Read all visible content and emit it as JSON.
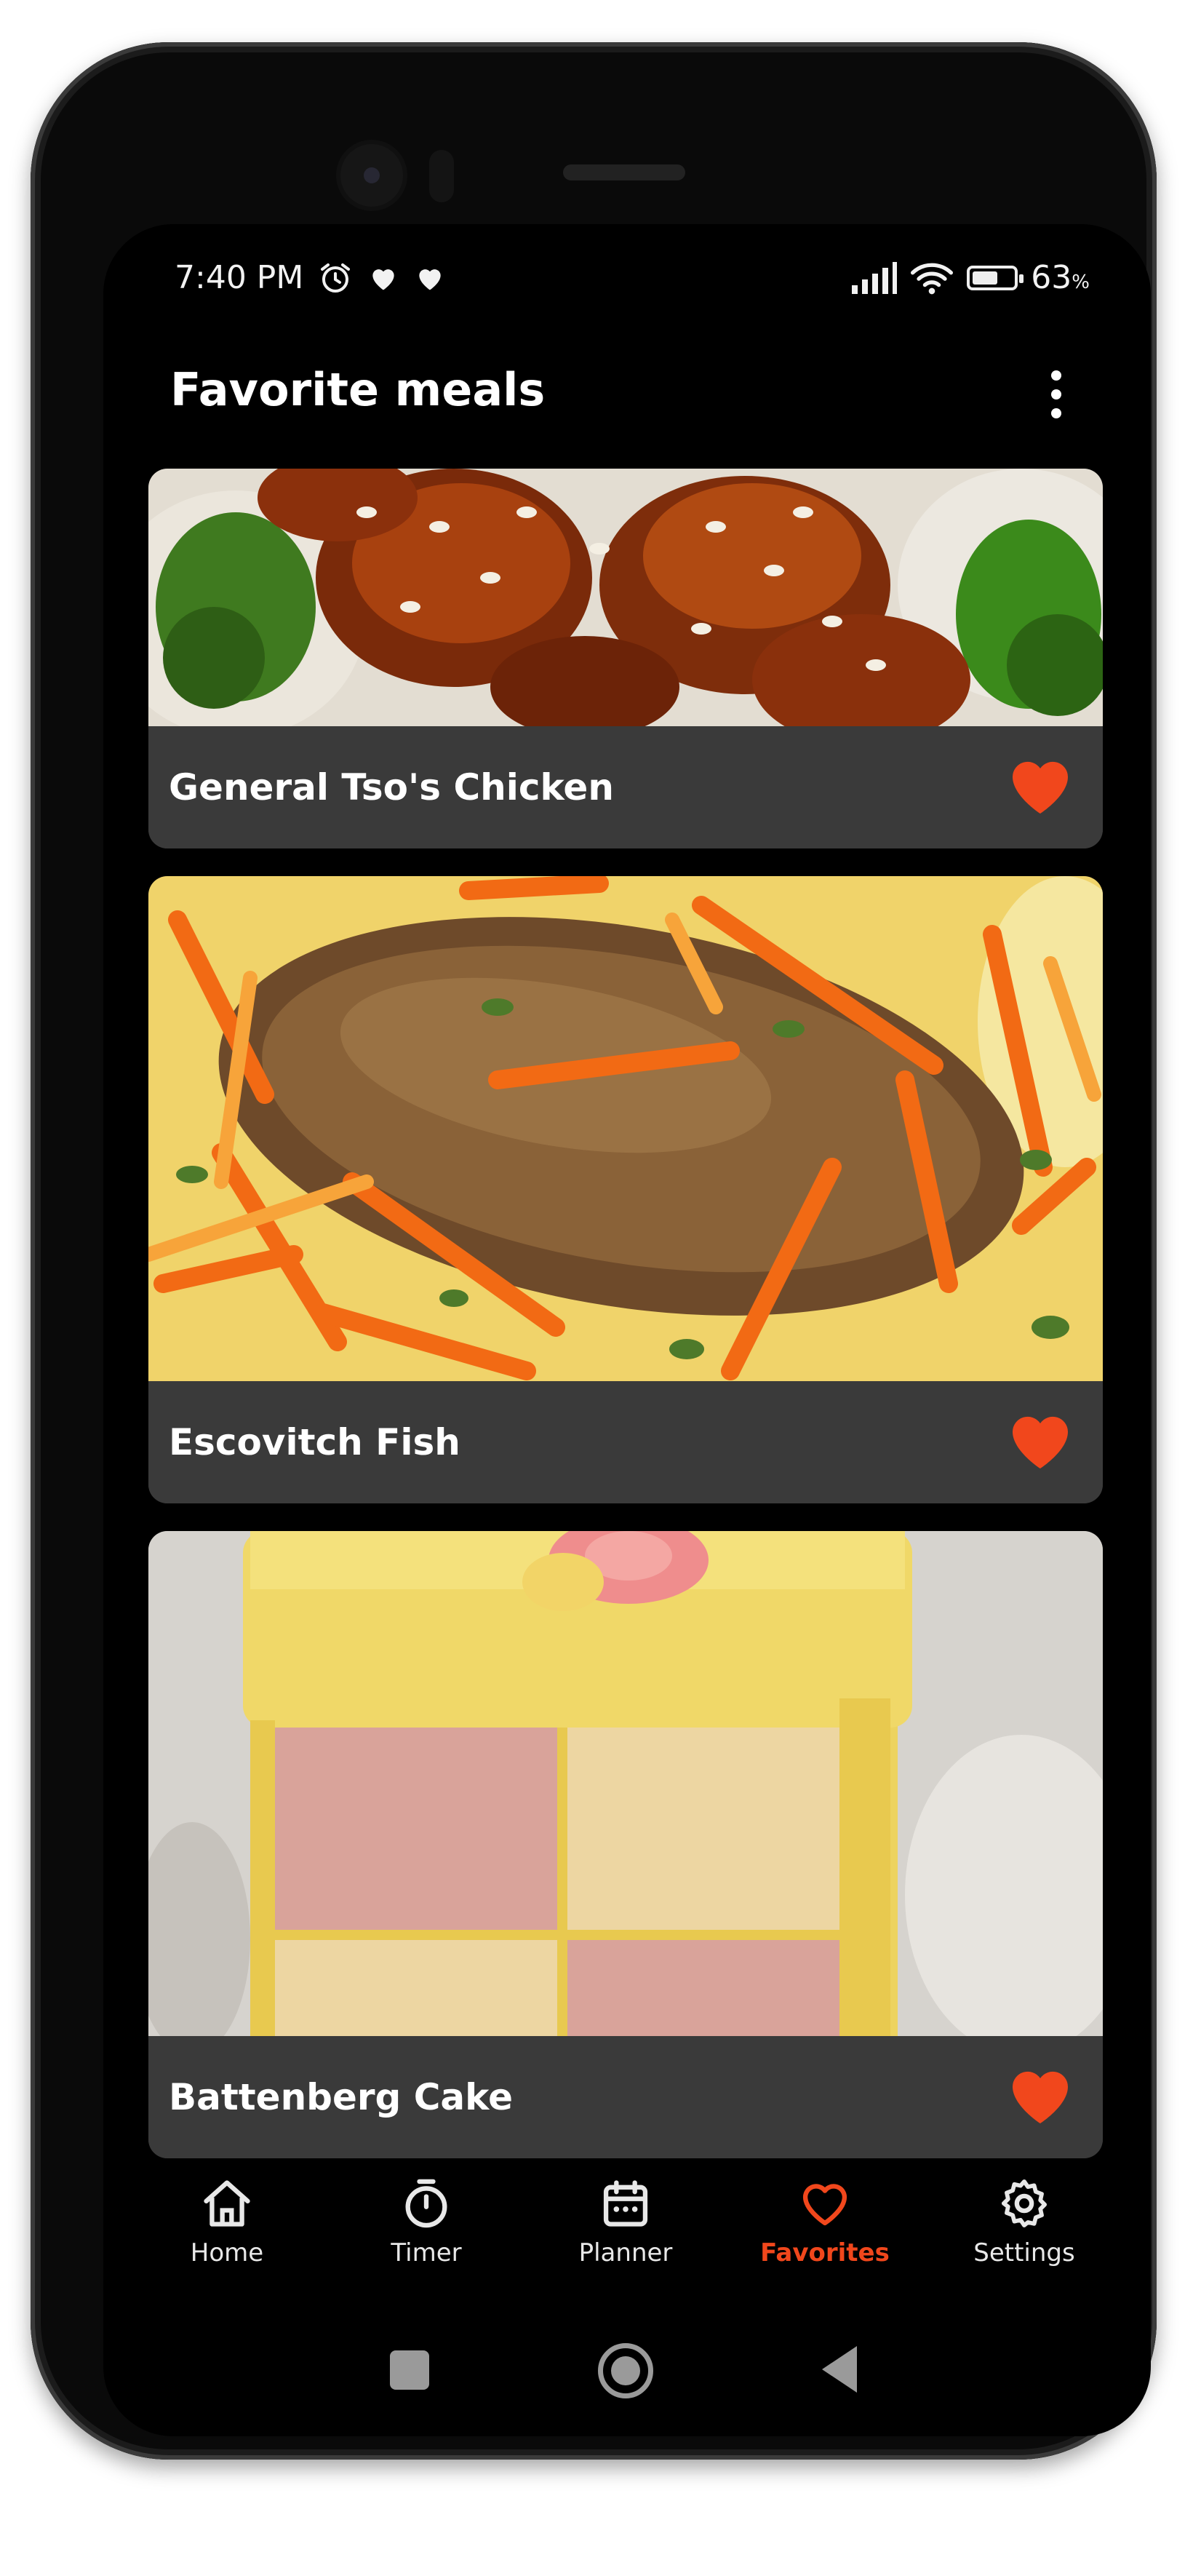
{
  "status": {
    "time": "7:40 PM",
    "battery_percent": "63",
    "battery_percent_sign": "%",
    "icons": [
      "alarm-icon",
      "heart-notification-icon",
      "heart-notification-icon",
      "signal-icon",
      "wifi-icon",
      "battery-icon"
    ]
  },
  "appbar": {
    "title": "Favorite meals",
    "menu_icon": "more-vert-icon"
  },
  "meals": [
    {
      "name": "General Tso's Chicken",
      "favorite": true
    },
    {
      "name": "Escovitch Fish",
      "favorite": true
    },
    {
      "name": "Battenberg Cake",
      "favorite": true
    }
  ],
  "nav": {
    "items": [
      {
        "label": "Home",
        "icon": "home-icon"
      },
      {
        "label": "Timer",
        "icon": "stopwatch-icon"
      },
      {
        "label": "Planner",
        "icon": "calendar-icon"
      },
      {
        "label": "Favorites",
        "icon": "heart-outline-icon",
        "active": true
      },
      {
        "label": "Settings",
        "icon": "gear-icon"
      }
    ]
  },
  "colors": {
    "accent": "#f1471c",
    "card": "#3a3a3a",
    "background": "#000000"
  }
}
